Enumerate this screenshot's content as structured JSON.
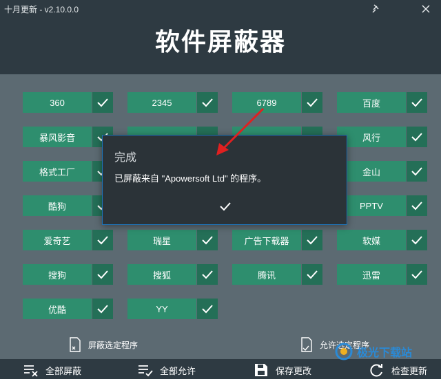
{
  "window": {
    "title": "十月更新 - v2.10.0.0",
    "pin_icon": "pin-icon",
    "close_icon": "close-icon"
  },
  "app": {
    "title": "软件屏蔽器"
  },
  "tiles": [
    {
      "label": "360",
      "checked": true
    },
    {
      "label": "2345",
      "checked": true
    },
    {
      "label": "6789",
      "checked": true
    },
    {
      "label": "百度",
      "checked": true
    },
    {
      "label": "暴风影音",
      "checked": true
    },
    {
      "label": "风行",
      "checked": true
    },
    {
      "label": "格式工厂",
      "checked": true
    },
    {
      "label": "金山",
      "checked": true
    },
    {
      "label": "酷狗",
      "checked": true
    },
    {
      "label": "PPTV",
      "checked": true
    },
    {
      "label": "爱奇艺",
      "checked": true
    },
    {
      "label": "瑞星",
      "checked": true
    },
    {
      "label": "广告下载器",
      "checked": true
    },
    {
      "label": "软媒",
      "checked": true
    },
    {
      "label": "搜狗",
      "checked": true
    },
    {
      "label": "搜狐",
      "checked": true
    },
    {
      "label": "腾讯",
      "checked": true
    },
    {
      "label": "迅雷",
      "checked": true
    },
    {
      "label": "优酷",
      "checked": true
    },
    {
      "label": "YY",
      "checked": true
    }
  ],
  "actions": {
    "block_selected": "屏蔽选定程序",
    "allow_selected": "允许选定程序"
  },
  "footer": {
    "block_all": "全部屏蔽",
    "allow_all": "全部允许",
    "save": "保存更改",
    "check_update": "检查更新"
  },
  "dialog": {
    "title": "完成",
    "message": "已屏蔽来自 \"Apowersoft Ltd\" 的程序。"
  },
  "watermark": {
    "text": "极光下载站"
  },
  "colors": {
    "header_bg": "#2e3a42",
    "content_bg": "#5c6a72",
    "tile_label": "#2e8e6e",
    "tile_check": "#246f57",
    "dialog_border": "#1e73b8",
    "arrow": "#e02020"
  }
}
